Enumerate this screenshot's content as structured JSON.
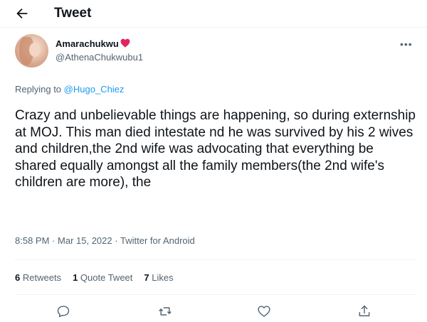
{
  "header": {
    "title": "Tweet"
  },
  "author": {
    "name": "Amarachukwu",
    "handle": "@AthenaChukwubu1"
  },
  "reply": {
    "prefix": "Replying to",
    "to": "@Hugo_Chiez"
  },
  "tweet": {
    "text": "Crazy and unbelievable things are happening, so during externship at MOJ. This man died intestate nd he was survived by his 2 wives and children,the 2nd wife was advocating that everything be shared equally amongst all the family members(the 2nd wife's children are more), the",
    "time": "8:58 PM",
    "date": "Mar 15, 2022",
    "source": "Twitter for Android"
  },
  "stats": {
    "retweets_count": "6",
    "retweets_label": "Retweets",
    "quotes_count": "1",
    "quotes_label": "Quote Tweet",
    "likes_count": "7",
    "likes_label": "Likes"
  },
  "icons": {
    "back": "arrow-left-icon",
    "badge": "heart-emoji-icon",
    "more": "more-horizontal-icon",
    "reply": "reply-icon",
    "retweet": "retweet-icon",
    "like": "like-icon",
    "share": "share-icon"
  },
  "colors": {
    "link": "#1d9bf0",
    "secondary_text": "#536471",
    "heart": "#e0245e"
  }
}
